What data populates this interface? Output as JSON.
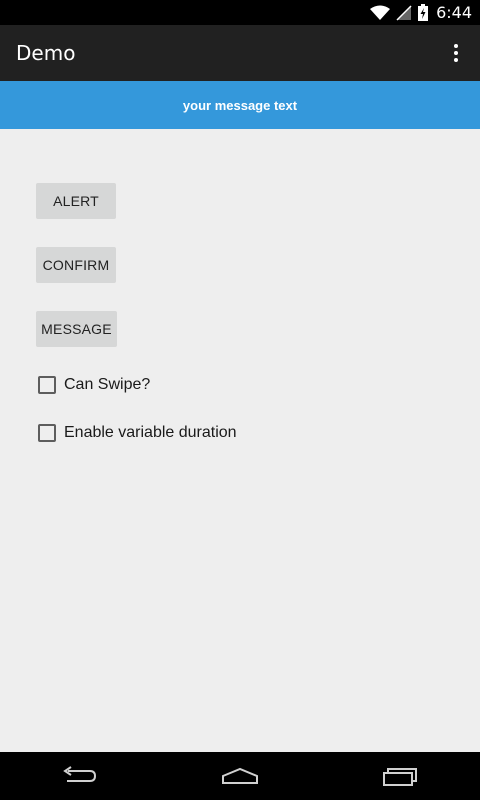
{
  "status_bar": {
    "time": "6:44",
    "icons": [
      "wifi-icon",
      "signal-icon",
      "battery-charging-icon"
    ]
  },
  "action_bar": {
    "title": "Demo",
    "overflow_icon": "overflow-menu-icon"
  },
  "crouton": {
    "text": "your message text",
    "color": "#3498db"
  },
  "buttons": {
    "alert": "ALERT",
    "confirm": "CONFIRM",
    "message": "MESSAGE"
  },
  "checkboxes": [
    {
      "label": "Can Swipe?",
      "checked": false
    },
    {
      "label": "Enable variable duration",
      "checked": false
    }
  ],
  "nav_bar": {
    "icons": [
      "back-icon",
      "home-icon",
      "recents-icon"
    ]
  }
}
